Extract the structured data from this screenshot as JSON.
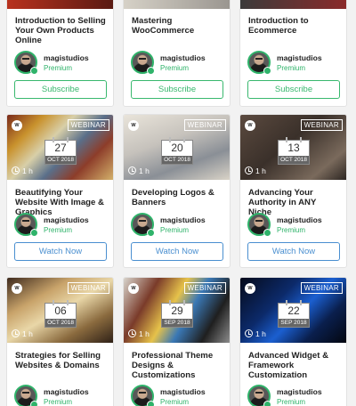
{
  "cards": [
    {
      "title": "Introduction to Selling Your Own Products Online",
      "author": {
        "name": "magistudios",
        "tier": "Premium"
      },
      "button": "Subscribe"
    },
    {
      "title": "Mastering WooCommerce",
      "author": {
        "name": "magistudios",
        "tier": "Premium"
      },
      "button": "Subscribe"
    },
    {
      "title": "Introduction to Ecommerce",
      "author": {
        "name": "magistudios",
        "tier": "Premium"
      },
      "button": "Subscribe"
    },
    {
      "title": "Beautifying Your Website With Image & Graphics",
      "tag": "WEBINAR",
      "logo": "W",
      "day": "27",
      "month": "OCT 2018",
      "duration": "1 h",
      "author": {
        "name": "magistudios",
        "tier": "Premium"
      },
      "button": "Watch Now"
    },
    {
      "title": "Developing Logos & Banners",
      "tag": "WEBINAR",
      "logo": "W",
      "day": "20",
      "month": "OCT 2018",
      "duration": "1 h",
      "author": {
        "name": "magistudios",
        "tier": "Premium"
      },
      "button": "Watch Now"
    },
    {
      "title": "Advancing Your Authority in ANY Niche",
      "tag": "WEBINAR",
      "logo": "W",
      "day": "13",
      "month": "OCT 2018",
      "duration": "1 h",
      "author": {
        "name": "magistudios",
        "tier": "Premium"
      },
      "button": "Watch Now"
    },
    {
      "title": "Strategies for Selling Websites & Domains",
      "tag": "WEBINAR",
      "logo": "W",
      "day": "06",
      "month": "OCT 2018",
      "duration": "1 h",
      "author": {
        "name": "magistudios",
        "tier": "Premium"
      }
    },
    {
      "title": "Professional Theme Designs & Customizations",
      "tag": "WEBINAR",
      "logo": "W",
      "day": "29",
      "month": "SEP 2018",
      "duration": "1 h",
      "author": {
        "name": "magistudios",
        "tier": "Premium"
      }
    },
    {
      "title": "Advanced Widget & Framework Customization",
      "tag": "WEBINAR",
      "logo": "W",
      "day": "22",
      "month": "SEP 2018",
      "duration": "1 h",
      "author": {
        "name": "magistudios",
        "tier": "Premium"
      }
    }
  ],
  "colors": {
    "premium": "#2fb36a",
    "subscribe": "#39b86e",
    "watch": "#4a8fd0"
  },
  "icons": {
    "clock": "clock-icon",
    "calendar": "calendar-icon",
    "brand": "brand-logo"
  }
}
